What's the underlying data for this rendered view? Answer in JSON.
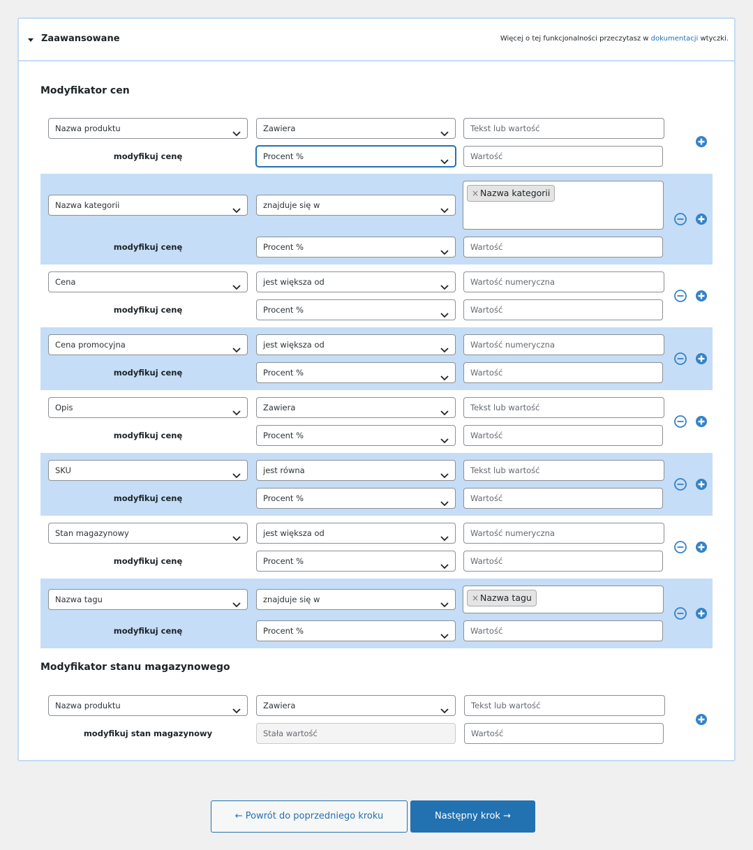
{
  "header": {
    "title": "Zaawansowane",
    "note_before": "Więcej o tej funkcjonalności przeczytasz w ",
    "note_link": "dokumentacji",
    "note_after": " wtyczki."
  },
  "price_section": {
    "title": "Modyfikator cen",
    "modify_label": "modyfikuj cenę",
    "rows": [
      {
        "field": "Nazwa produktu",
        "operator": "Zawiera",
        "value_placeholder": "Tekst lub wartość",
        "modifier": "Procent %",
        "amount_placeholder": "Wartość"
      },
      {
        "field": "Nazwa kategorii",
        "operator": "znajduje się w",
        "tag": "Nazwa kategorii",
        "modifier": "Procent %",
        "amount_placeholder": "Wartość"
      },
      {
        "field": "Cena",
        "operator": "jest większa od",
        "value_placeholder": "Wartość numeryczna",
        "modifier": "Procent %",
        "amount_placeholder": "Wartość"
      },
      {
        "field": "Cena promocyjna",
        "operator": "jest większa od",
        "value_placeholder": "Wartość numeryczna",
        "modifier": "Procent %",
        "amount_placeholder": "Wartość"
      },
      {
        "field": "Opis",
        "operator": "Zawiera",
        "value_placeholder": "Tekst lub wartość",
        "modifier": "Procent %",
        "amount_placeholder": "Wartość"
      },
      {
        "field": "SKU",
        "operator": "jest równa",
        "value_placeholder": "Tekst lub wartość",
        "modifier": "Procent %",
        "amount_placeholder": "Wartość"
      },
      {
        "field": "Stan magazynowy",
        "operator": "jest większa od",
        "value_placeholder": "Wartość numeryczna",
        "modifier": "Procent %",
        "amount_placeholder": "Wartość"
      },
      {
        "field": "Nazwa tagu",
        "operator": "znajduje się w",
        "tag": "Nazwa tagu",
        "modifier": "Procent %",
        "amount_placeholder": "Wartość"
      }
    ]
  },
  "stock_section": {
    "title": "Modyfikator stanu magazynowego",
    "modify_label": "modyfikuj stan magazynowy",
    "row": {
      "field": "Nazwa produktu",
      "operator": "Zawiera",
      "value_placeholder": "Tekst lub wartość",
      "modifier": "Stała wartość",
      "amount_placeholder": "Wartość"
    }
  },
  "buttons": {
    "back": "← Powrót do poprzedniego kroku",
    "next": "Następny krok →"
  },
  "icons": {
    "add": "plus-circle-icon",
    "remove": "minus-circle-icon",
    "dropdown": "chevron-down-icon"
  },
  "colors": {
    "accent": "#2271b1",
    "alt_row": "#c5ddf6",
    "icon_blue": "#3582c4"
  }
}
